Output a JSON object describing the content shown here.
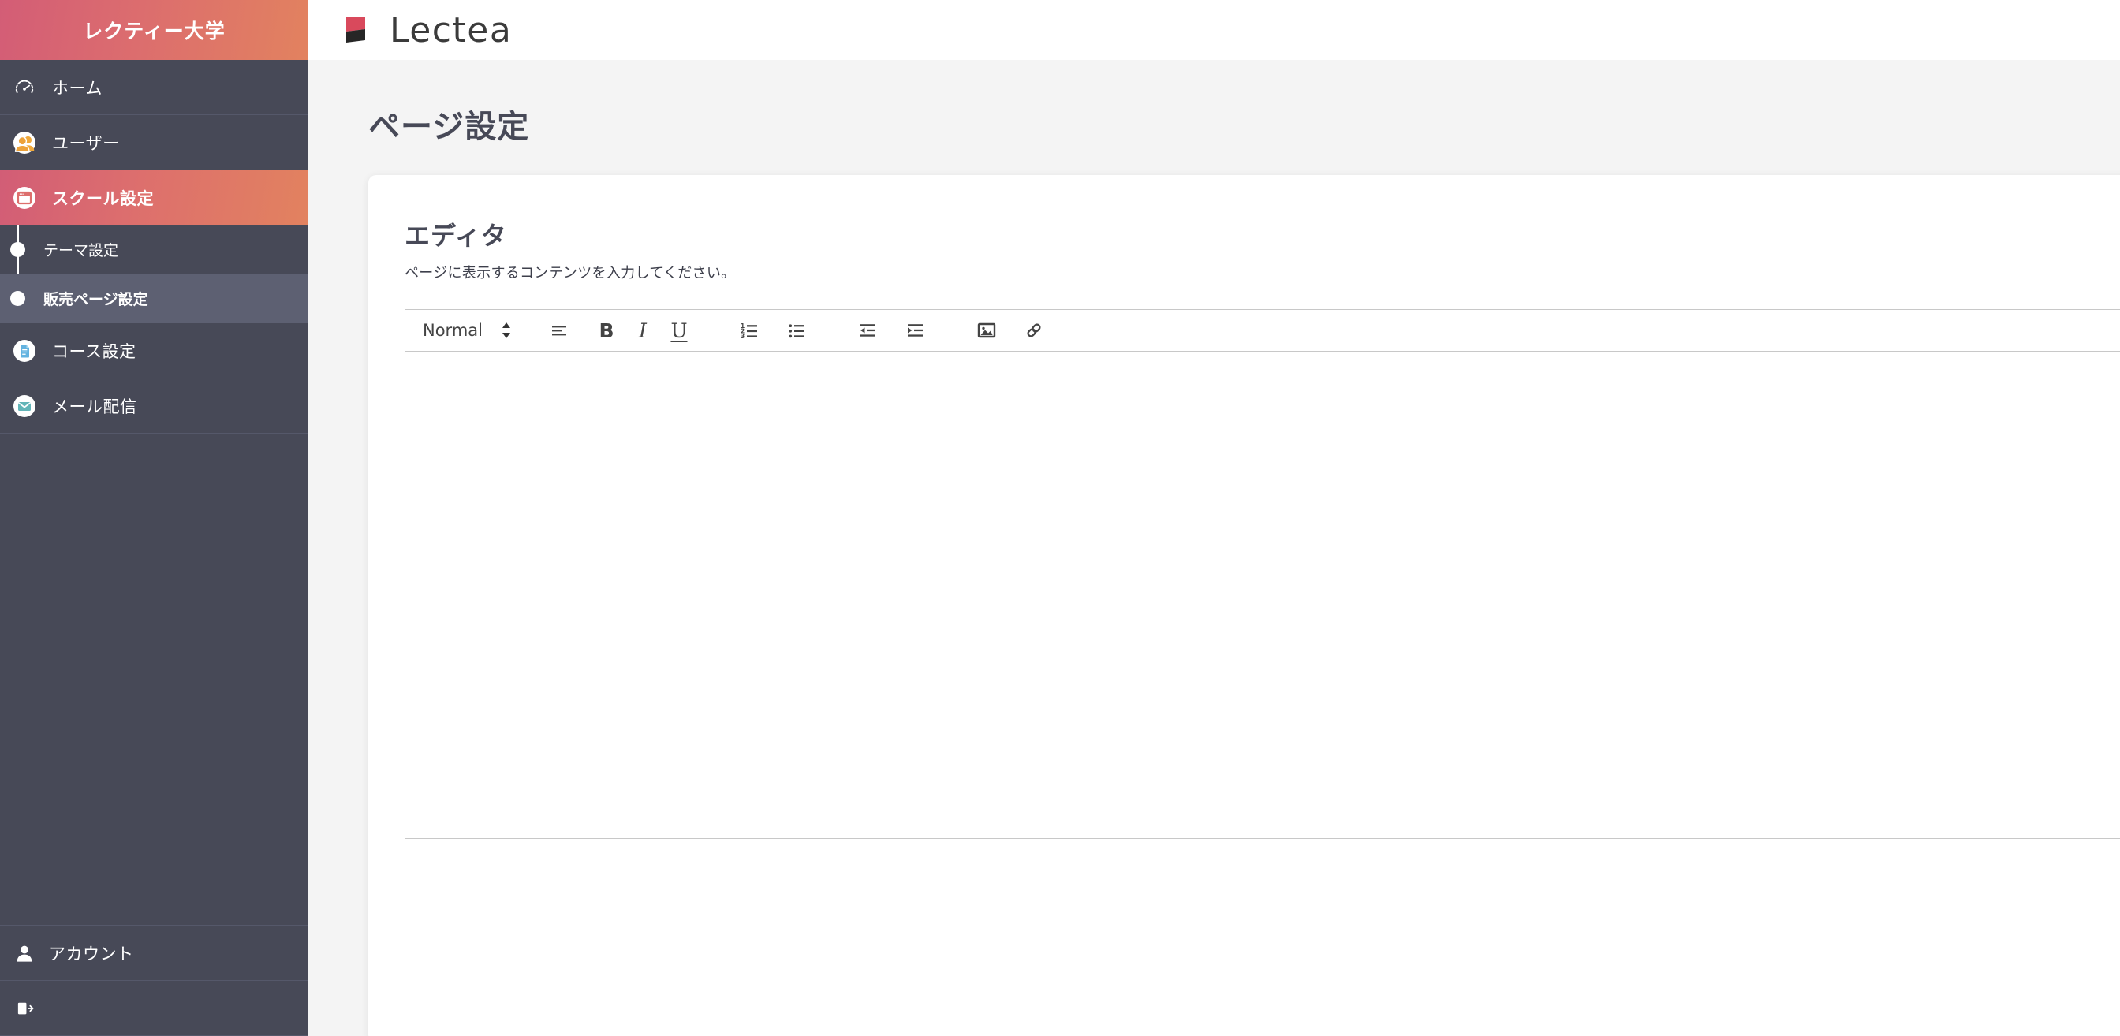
{
  "sidebar": {
    "brand": "レクティー大学",
    "items": [
      {
        "label": "ホーム",
        "icon": "dashboard-gauge-icon",
        "id": "home"
      },
      {
        "label": "ユーザー",
        "icon": "users-icon",
        "id": "users"
      },
      {
        "label": "スクール設定",
        "icon": "browser-window-icon",
        "id": "school-settings",
        "active": true
      }
    ],
    "submenu": [
      {
        "label": "テーマ設定",
        "id": "theme-settings",
        "active": false
      },
      {
        "label": "販売ページ設定",
        "id": "sales-page-settings",
        "active": true
      }
    ],
    "items_after": [
      {
        "label": "コース設定",
        "icon": "document-icon",
        "id": "course-settings"
      },
      {
        "label": "メール配信",
        "icon": "envelope-icon",
        "id": "mail-delivery"
      }
    ],
    "footer_items": [
      {
        "label": "アカウント",
        "icon": "person-icon",
        "id": "account"
      }
    ]
  },
  "topbar": {
    "logo_text": "Lectea",
    "logo_colors": {
      "top": "#d9495c",
      "bottom": "#262626"
    }
  },
  "page": {
    "title": "ページ設定"
  },
  "editor_card": {
    "title": "エディタ",
    "description": "ページに表示するコンテンツを入力してください。",
    "toolbar": {
      "format_picker": {
        "value": "Normal",
        "icon": "chevron-updown-icon"
      },
      "buttons": [
        {
          "id": "align",
          "label": "",
          "icon": "align-left-icon"
        },
        {
          "id": "bold",
          "label": "B",
          "icon": "bold-icon"
        },
        {
          "id": "italic",
          "label": "I",
          "icon": "italic-icon"
        },
        {
          "id": "underline",
          "label": "U",
          "icon": "underline-icon"
        },
        {
          "id": "ordered-list",
          "label": "",
          "icon": "ordered-list-icon"
        },
        {
          "id": "bullet-list",
          "label": "",
          "icon": "bullet-list-icon"
        },
        {
          "id": "outdent",
          "label": "",
          "icon": "outdent-icon"
        },
        {
          "id": "indent",
          "label": "",
          "icon": "indent-icon"
        },
        {
          "id": "image",
          "label": "",
          "icon": "image-icon"
        },
        {
          "id": "link",
          "label": "",
          "icon": "link-chain-icon"
        }
      ]
    },
    "body_content": ""
  },
  "theme": {
    "sidebar_bg": "#474957",
    "sidebar_divider": "#55588a",
    "gradient_start": "#d35d76",
    "gradient_end": "#e2825f",
    "submenu_active_bg": "#5d6072",
    "content_bg": "#f4f4f4",
    "heading_color": "#474957"
  }
}
